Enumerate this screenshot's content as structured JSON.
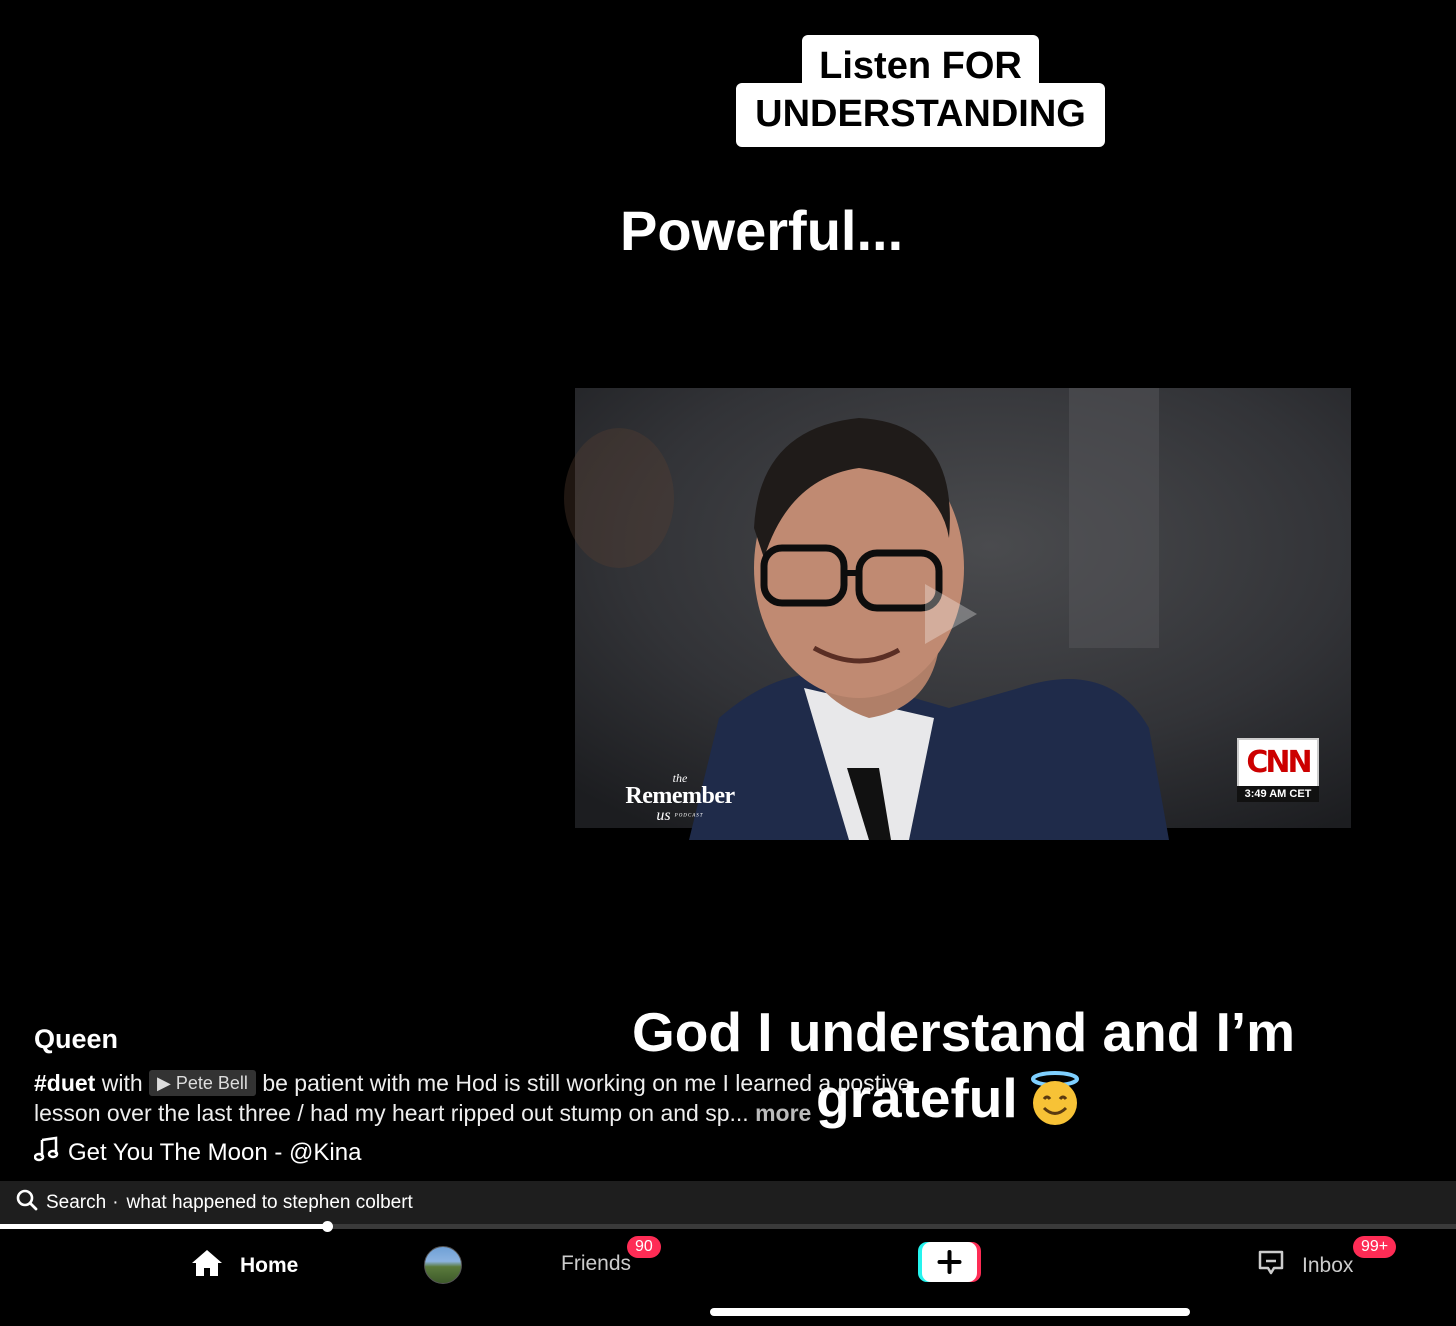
{
  "overlays": {
    "sticker_line1": "Listen FOR",
    "sticker_line2": "UNDERSTANDING",
    "powerful": "Powerful...",
    "bottom_line1": "God I understand and I’m",
    "bottom_line2": "grateful"
  },
  "video": {
    "watermark_the": "the",
    "watermark_main": "Remember",
    "watermark_us": "us",
    "watermark_podcast": "PODCAST",
    "network_logo": "CNN",
    "network_time": "3:49 AM CET"
  },
  "post": {
    "username": "Queen",
    "hashtag": "#duet",
    "with_text": "with",
    "mention": "▶ Pete Bell",
    "caption": "be patient with me Hod is still working on me I learned a postive lesson over the last three / had my heart ripped out stump on and sp...",
    "more_label": "more",
    "sound": "Get You The Moon - @Kina"
  },
  "search": {
    "label": "Search",
    "separator": "·",
    "query": "what happened to stephen colbert"
  },
  "playback": {
    "progress_fraction": 0.225
  },
  "nav": {
    "home": "Home",
    "friends": "Friends",
    "friends_badge": "90",
    "inbox": "Inbox",
    "inbox_badge": "99+"
  },
  "colors": {
    "accent_pink": "#fe2c55",
    "accent_cyan": "#25f4ee",
    "cnn_red": "#cc0000"
  }
}
